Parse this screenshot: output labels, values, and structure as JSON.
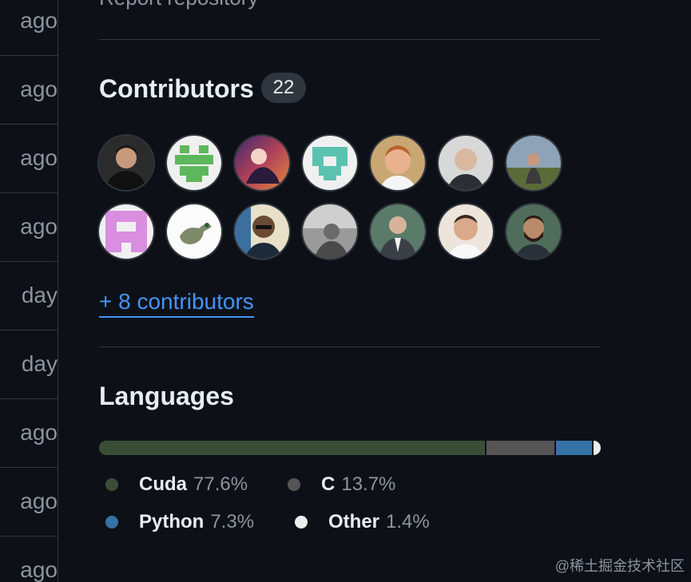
{
  "timeline": {
    "rows": [
      "ago",
      "ago",
      "ago",
      "ago",
      "day",
      "day",
      "ago",
      "ago",
      "ago"
    ]
  },
  "sidebar": {
    "report_link": "Report repository",
    "contributors": {
      "title": "Contributors",
      "count": "22",
      "more_link": "+ 8 contributors",
      "avatars": [
        {
          "name": "avatar-contributor-1",
          "style": "photo-dark-man"
        },
        {
          "name": "avatar-contributor-2",
          "style": "identicon-green"
        },
        {
          "name": "avatar-contributor-3",
          "style": "artwork-purple"
        },
        {
          "name": "avatar-contributor-4",
          "style": "identicon-teal"
        },
        {
          "name": "avatar-contributor-5",
          "style": "photo-ginger-man"
        },
        {
          "name": "avatar-contributor-6",
          "style": "photo-man"
        },
        {
          "name": "avatar-contributor-7",
          "style": "photo-outdoor"
        },
        {
          "name": "avatar-contributor-8",
          "style": "identicon-pink"
        },
        {
          "name": "avatar-contributor-9",
          "style": "duck-drawing"
        },
        {
          "name": "avatar-contributor-10",
          "style": "photo-man-glasses"
        },
        {
          "name": "avatar-contributor-11",
          "style": "photo-grayscale"
        },
        {
          "name": "avatar-contributor-12",
          "style": "photo-suit"
        },
        {
          "name": "avatar-contributor-13",
          "style": "photo-smiling-man"
        },
        {
          "name": "avatar-contributor-14",
          "style": "photo-bearded-man"
        }
      ]
    },
    "languages": {
      "title": "Languages",
      "items": [
        {
          "name": "Cuda",
          "percent": "77.6%",
          "value": 77.6,
          "color": "#3a4e37"
        },
        {
          "name": "C",
          "percent": "13.7%",
          "value": 13.7,
          "color": "#555555"
        },
        {
          "name": "Python",
          "percent": "7.3%",
          "value": 7.3,
          "color": "#3572A5"
        },
        {
          "name": "Other",
          "percent": "1.4%",
          "value": 1.4,
          "color": "#ededed"
        }
      ]
    }
  },
  "watermark": "@稀土掘金技术社区"
}
